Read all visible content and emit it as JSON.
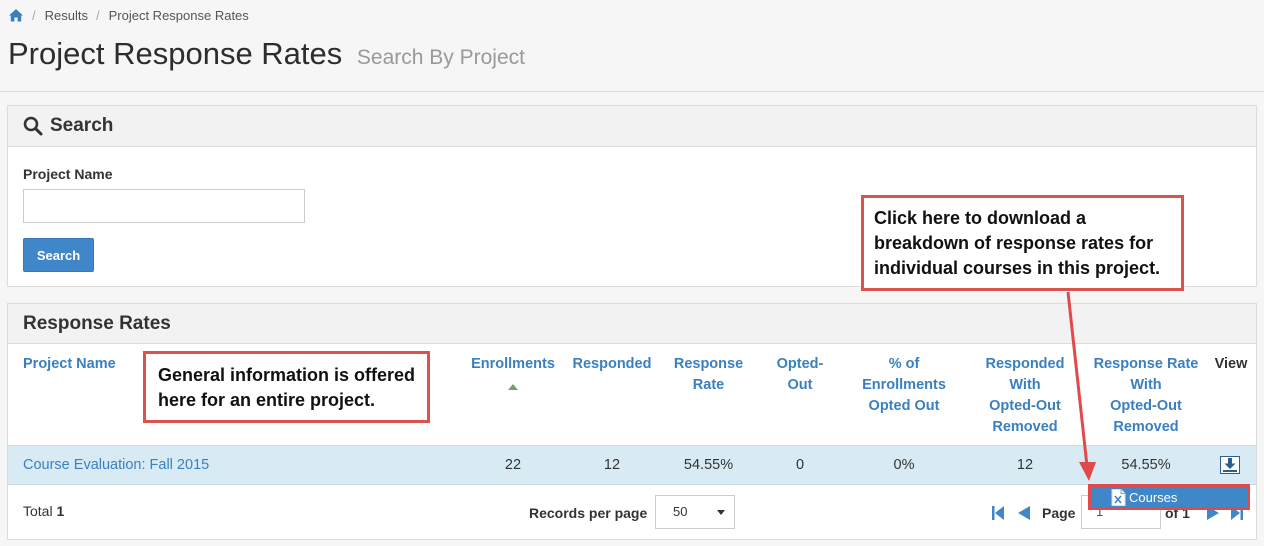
{
  "breadcrumb": {
    "home_icon": "home-icon",
    "items": [
      "Results",
      "Project Response Rates"
    ]
  },
  "page": {
    "title": "Project Response Rates",
    "subtitle": "Search By Project"
  },
  "search_panel": {
    "heading": "Search",
    "heading_icon": "search-icon",
    "field_label": "Project Name",
    "field_value": "",
    "button_label": "Search"
  },
  "rates_panel": {
    "heading": "Response Rates",
    "columns": {
      "project_name": "Project Name",
      "enrollments": "Enrollments",
      "responded": "Responded",
      "response_rate": [
        "Response",
        "Rate"
      ],
      "opted_out": [
        "Opted-",
        "Out"
      ],
      "pct_enrollments_opted_out": [
        "% of",
        "Enrollments",
        "Opted Out"
      ],
      "responded_with_opted_out_removed": [
        "Responded",
        "With",
        "Opted-Out",
        "Removed"
      ],
      "response_rate_with_opted_out_removed": [
        "Response Rate",
        "With",
        "Opted-Out",
        "Removed"
      ],
      "view": "View"
    },
    "rows": [
      {
        "project_name": "Course Evaluation: Fall 2015",
        "enrollments": "22",
        "responded": "12",
        "response_rate": "54.55%",
        "opted_out": "0",
        "pct_enrollments_opted_out": "0%",
        "responded_with_opted_out_removed": "12",
        "response_rate_with_opted_out_removed": "54.55%",
        "view_icon": "download-icon"
      }
    ],
    "footer": {
      "total_label": "Total",
      "total_value": "1",
      "records_per_page_label": "Records per page",
      "records_per_page_value": "50",
      "page_label": "Page",
      "page_value": "1",
      "page_of": "of 1"
    },
    "dropdown": {
      "item_label": "Courses",
      "item_icon": "excel-file-icon"
    }
  },
  "callouts": {
    "download": [
      "Click here to download a",
      "breakdown of response rates for",
      "individual courses in this project."
    ],
    "general": [
      "General information is offered",
      "here for an entire project."
    ]
  },
  "colors": {
    "accent": "#3f87c8",
    "link": "#3a80c0",
    "row_highlight": "#d8ebf5",
    "callout_border": "#d9534f"
  }
}
